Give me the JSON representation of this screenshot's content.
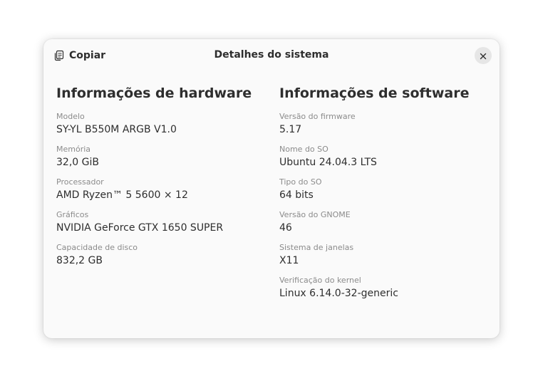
{
  "header": {
    "copy_label": "Copiar",
    "title": "Detalhes do sistema",
    "copy_icon": "copy-icon",
    "close_icon": "close-icon"
  },
  "hardware": {
    "title": "Informações de hardware",
    "fields": [
      {
        "label": "Modelo",
        "value": "SY-YL B550M ARGB V1.0"
      },
      {
        "label": "Memória",
        "value": "32,0 GiB"
      },
      {
        "label": "Processador",
        "value": "AMD Ryzen™ 5 5600 × 12"
      },
      {
        "label": "Gráficos",
        "value": "NVIDIA GeForce GTX 1650 SUPER"
      },
      {
        "label": "Capacidade de disco",
        "value": "832,2 GB"
      }
    ]
  },
  "software": {
    "title": "Informações de software",
    "fields": [
      {
        "label": "Versão do firmware",
        "value": "5.17"
      },
      {
        "label": "Nome do SO",
        "value": "Ubuntu 24.04.3 LTS"
      },
      {
        "label": "Tipo do SO",
        "value": "64 bits"
      },
      {
        "label": "Versão do GNOME",
        "value": "46"
      },
      {
        "label": "Sistema de janelas",
        "value": "X11"
      },
      {
        "label": "Verificação do kernel",
        "value": "Linux 6.14.0-32-generic"
      }
    ]
  }
}
